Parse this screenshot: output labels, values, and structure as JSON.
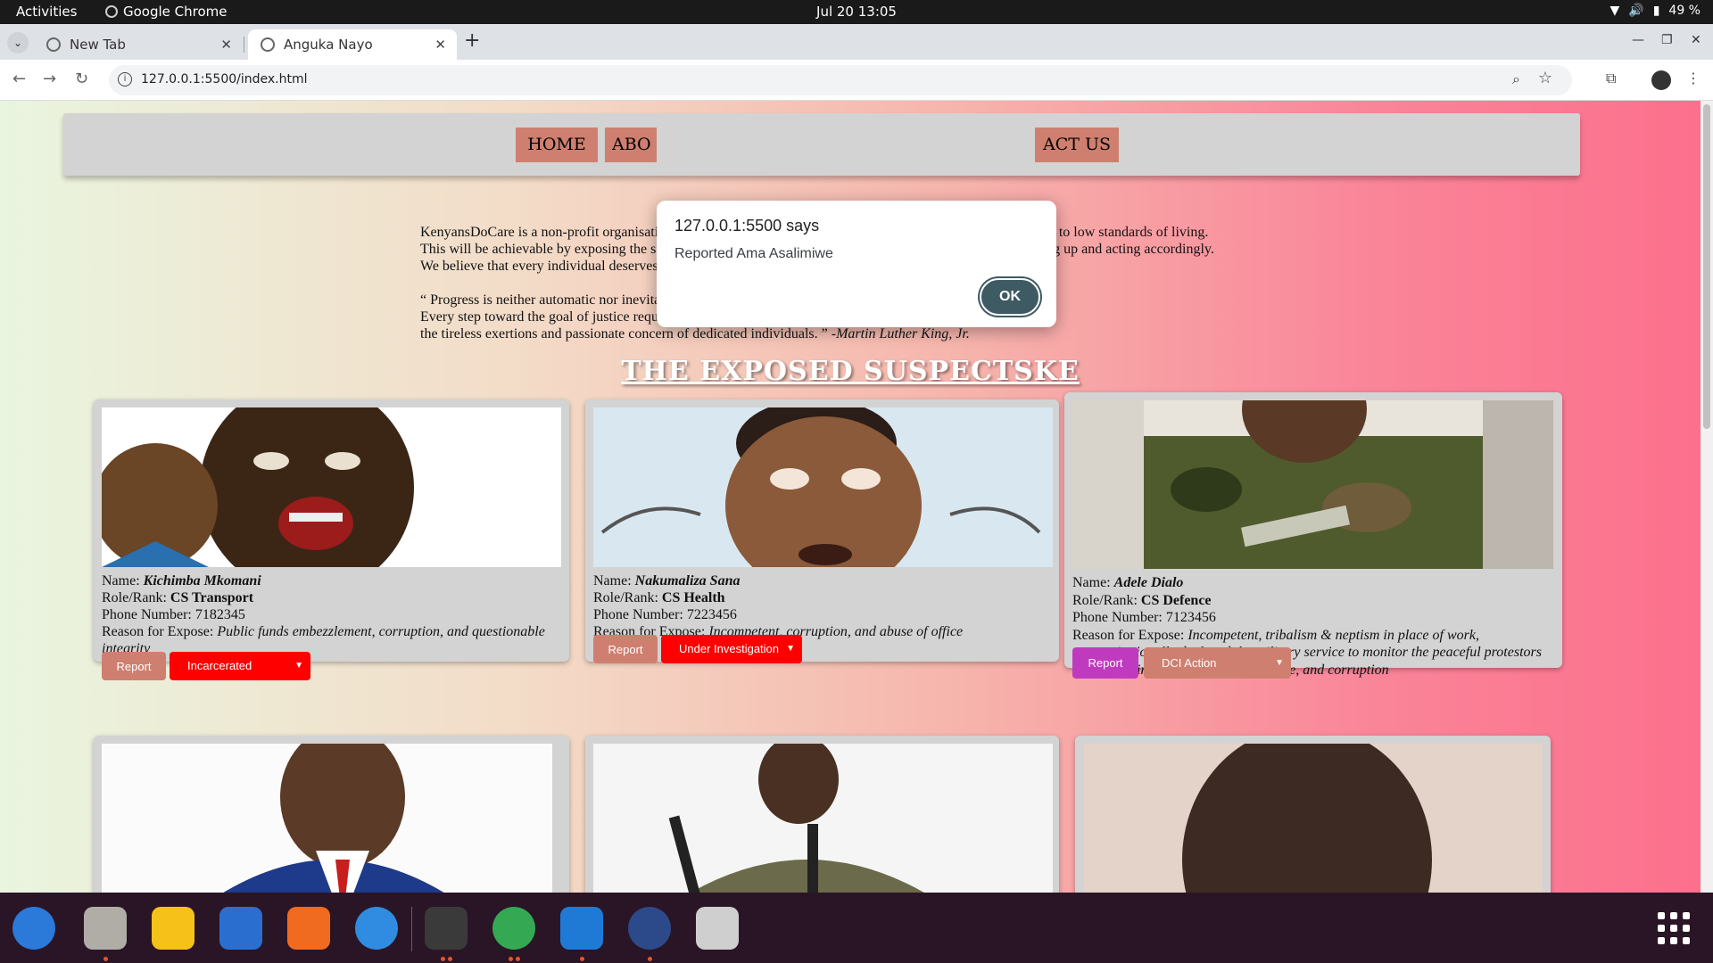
{
  "system_bar": {
    "activities": "Activities",
    "app_name": "Google Chrome",
    "clock": "Jul 20  13:05",
    "battery": "49 %"
  },
  "browser": {
    "tabs": [
      {
        "label": "New Tab",
        "active": false
      },
      {
        "label": "Anguka Nayo",
        "active": true
      }
    ],
    "url": "127.0.0.1:5500/index.html"
  },
  "nav": {
    "home": "HOME",
    "about": "ABO",
    "contact": "ACT US"
  },
  "about": {
    "line1": "KenyansDoCare is a non-profit organisation seeking to address issues corruption, and social inequality, leading to low standards of living.",
    "line2": "This will be achievable by exposing the suspected corruption incidences to help the judicial system in following up and acting accordingly.",
    "line3": "We believe that every individual deserves equal opportunities and resources.",
    "quote1": "“ Progress is neither automatic nor inevitable…",
    "quote2": "Every step toward the goal of justice requires sacrifice, suffering, and struggle;",
    "quote3": "the tireless exertions and passionate concern of dedicated individuals. ”",
    "quote_author": "-Martin Luther King, Jr."
  },
  "section_title": "THE EXPOSED SUSPECTSKE",
  "labels": {
    "name": "Name: ",
    "role": "Role/Rank: ",
    "phone": "Phone Number: ",
    "reason": "Reason for Expose: ",
    "report_button": "Report"
  },
  "suspects": [
    {
      "name": "Kichimba Mkomani",
      "role": "CS Transport",
      "phone": "7182345",
      "reason": "Public funds embezzlement, corruption, and questionable integrity",
      "status": "Incarcerated",
      "status_color": "#ff0000",
      "report_color": "#cf7f6f"
    },
    {
      "name": "Nakumaliza Sana",
      "role": "CS Health",
      "phone": "7223456",
      "reason": "Incompetent, corruption, and abuse of office",
      "status": "Under Investigation",
      "status_color": "#ff0000",
      "report_color": "#cf7f6f"
    },
    {
      "name": "Adele Dialo",
      "role": "CS Defence",
      "phone": "7123456",
      "reason": "Incompetent, tribalism & neptism in place of work, unconstitutionally deployed the military service to monitor the peaceful protestors demonstrating against bad governance, and corruption",
      "status": "DCI Action",
      "status_color": "#cf7f6f",
      "report_color": "#c03ac0"
    }
  ],
  "dialog": {
    "title": "127.0.0.1:5500 says",
    "message": "Reported Ama Asalimiwe",
    "ok_label": "OK"
  },
  "colors": {
    "nav_button": "#cf7f6f",
    "card_bg": "#d3d3d3",
    "dialog_ok": "#3e5a63"
  }
}
